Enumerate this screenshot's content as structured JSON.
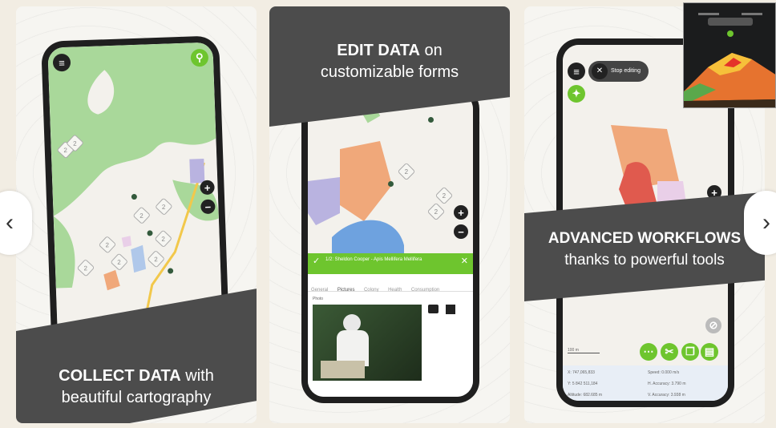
{
  "panels": [
    {
      "caption_bold": "COLLECT DATA",
      "caption_rest": " with",
      "caption_line2": "beautiful cartography"
    },
    {
      "caption_bold": "EDIT DATA",
      "caption_rest": " on",
      "caption_line2": "customizable forms"
    },
    {
      "caption_bold": "ADVANCED WORKFLOWS",
      "caption_line2": "thanks to powerful tools"
    }
  ],
  "map_badge_number": "2",
  "form": {
    "title": "1/2: Sheldon Cooper - Apis Mellifera Mellifera",
    "tabs": [
      "General",
      "Pictures",
      "Colony",
      "Health",
      "Consumption"
    ],
    "photo_label": "Photo"
  },
  "workflow": {
    "stop_button": "Stop editing",
    "scale_label": "100 m",
    "readouts": [
      [
        "X: 747,065,833",
        "Speed: 0.000 m/s"
      ],
      [
        "Y: 5 842 511,184",
        "H. Accuracy: 3.790 m"
      ],
      [
        "Altitude: 682.685 m",
        "V. Accuracy: 3.938 m"
      ]
    ]
  },
  "nav": {
    "prev": "‹",
    "next": "›"
  },
  "colors": {
    "green": "#6ec52e",
    "band": "#4c4c4c"
  }
}
